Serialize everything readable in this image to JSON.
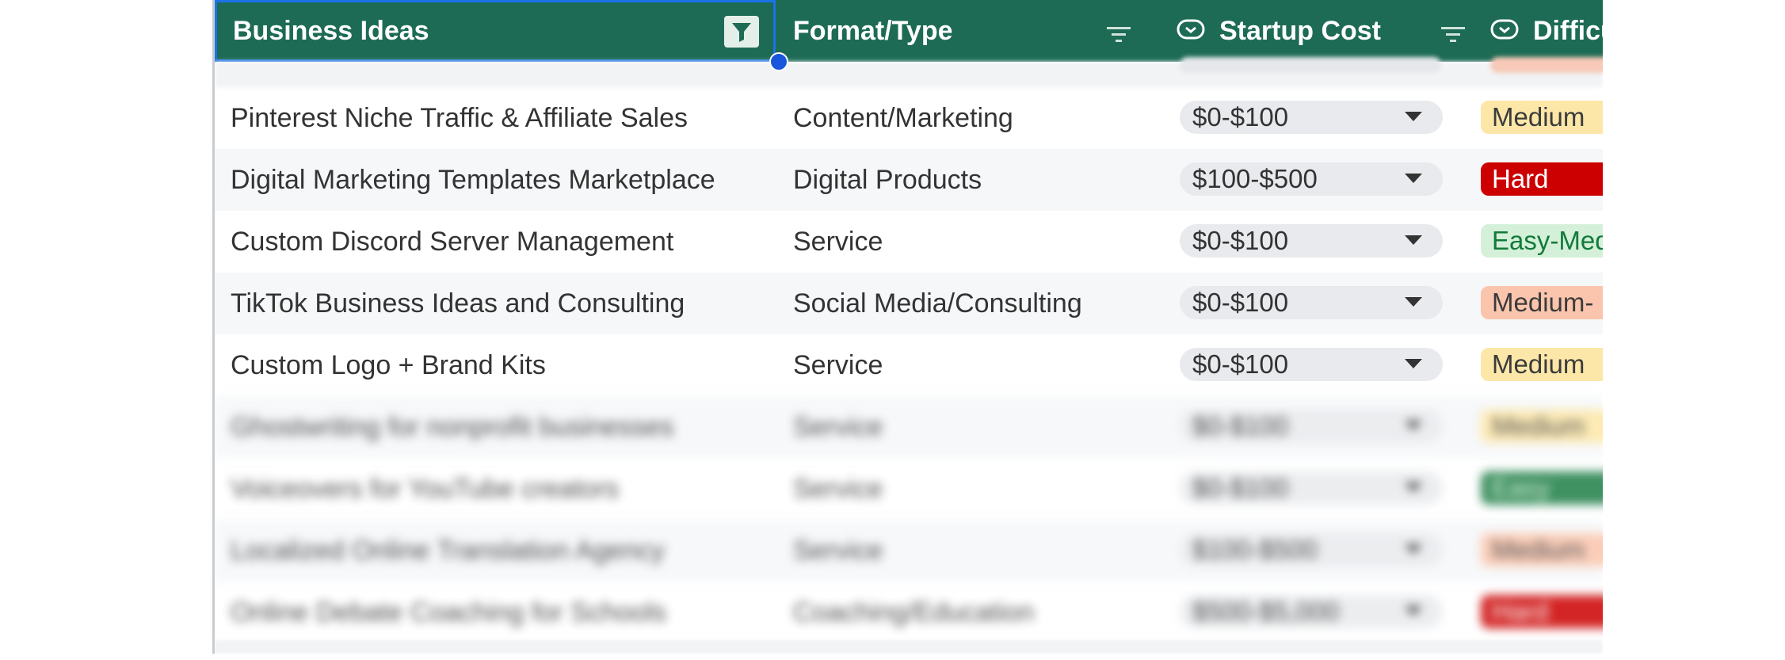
{
  "header": {
    "col_ideas": "Business Ideas",
    "col_format": "Format/Type",
    "col_cost": "Startup Cost",
    "col_difficulty": "Difficu"
  },
  "colors": {
    "header_bg": "#1d6b55",
    "selection": "#1a73e8",
    "medium": "#fde7a8",
    "hard": "#cc0000",
    "easy_medium": "#d4f0d8",
    "medium_plus": "#fbc5ad",
    "easy": "#1e7e46"
  },
  "rows": [
    {
      "idea": "Pinterest Niche Traffic & Affiliate Sales",
      "format": "Content/Marketing",
      "cost": "$0-$100",
      "difficulty": "Medium",
      "level": "medium"
    },
    {
      "idea": "Digital Marketing Templates Marketplace",
      "format": "Digital Products",
      "cost": "$100-$500",
      "difficulty": "Hard",
      "level": "hard"
    },
    {
      "idea": "Custom Discord Server Management",
      "format": "Service",
      "cost": "$0-$100",
      "difficulty": "Easy-Med",
      "level": "easymed"
    },
    {
      "idea": "TikTok Business Ideas and Consulting",
      "format": "Social Media/Consulting",
      "cost": "$0-$100",
      "difficulty": "Medium-",
      "level": "mediumplus"
    },
    {
      "idea": "Custom Logo + Brand Kits",
      "format": "Service",
      "cost": "$0-$100",
      "difficulty": "Medium",
      "level": "medium"
    },
    {
      "idea": "Ghostwriting for nonprofit businesses",
      "format": "Service",
      "cost": "$0-$100",
      "difficulty": "Medium",
      "level": "medium"
    },
    {
      "idea": "Voiceovers for YouTube creators",
      "format": "Service",
      "cost": "$0-$100",
      "difficulty": "Easy",
      "level": "easy"
    },
    {
      "idea": "Localized Online Translation Agency",
      "format": "Service",
      "cost": "$100-$500",
      "difficulty": "Medium",
      "level": "mediumplus"
    },
    {
      "idea": "Online Debate Coaching for Schools",
      "format": "Coaching/Education",
      "cost": "$500-$5,000",
      "difficulty": "Hard",
      "level": "hard"
    }
  ]
}
